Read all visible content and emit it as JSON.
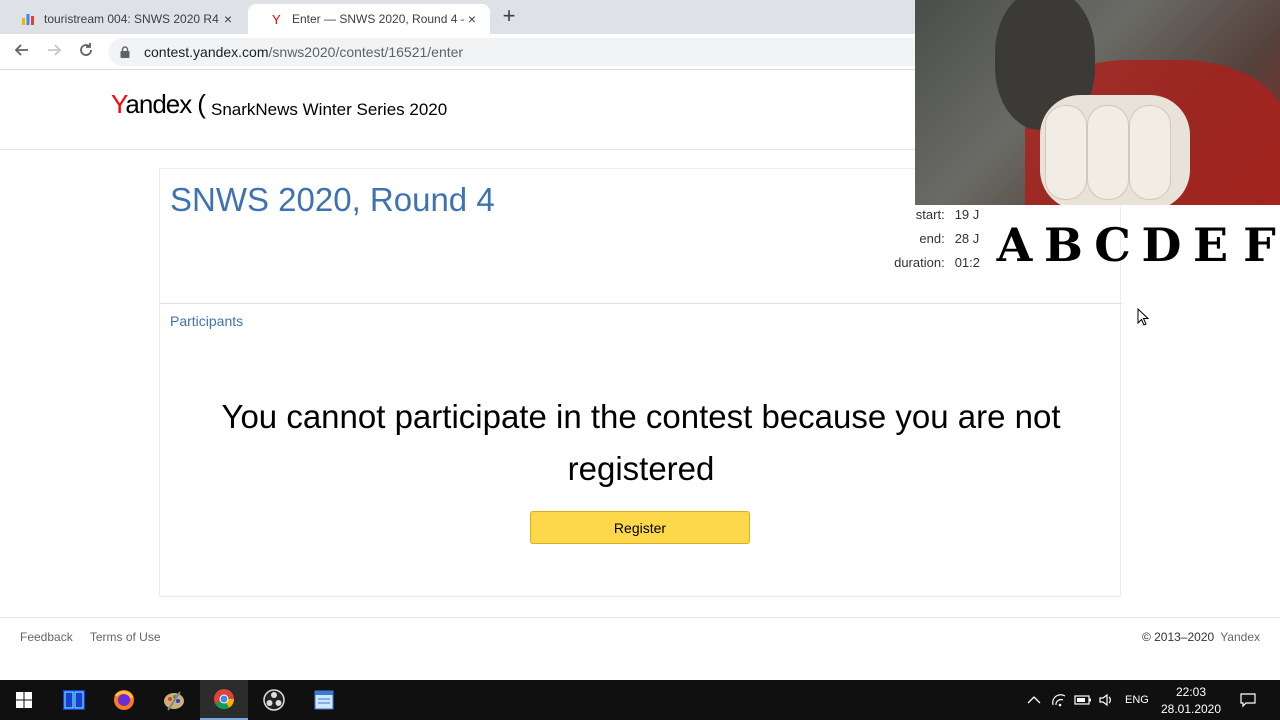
{
  "browser": {
    "tabs": [
      {
        "title": "touristream 004: SNWS 2020 R4",
        "active": false,
        "favicon": "bar-chart-favicon"
      },
      {
        "title": "Enter — SNWS 2020, Round 4 —",
        "active": true,
        "favicon": "yandex-favicon"
      }
    ],
    "close_glyph": "×",
    "new_tab_glyph": "+",
    "url_host": "contest.yandex.com",
    "url_path": "/snws2020/contest/16521/enter"
  },
  "header": {
    "logo_y": "Y",
    "logo_rest": "andex",
    "logo_suffix": "(",
    "contest_series": "SnarkNews Winter Series 2020"
  },
  "contest": {
    "title": "SNWS 2020, Round 4",
    "start_label": "start:",
    "start_value": "19 J",
    "end_label": "end:",
    "end_value": "28 J",
    "duration_label": "duration:",
    "duration_value": "01:2",
    "participants_link": "Participants",
    "message": "You cannot participate in the contest because you are not registered",
    "register_label": "Register"
  },
  "overlay_letters": [
    "A",
    "B",
    "C",
    "D",
    "E",
    "F"
  ],
  "footer": {
    "feedback": "Feedback",
    "terms": "Terms of Use",
    "copyright": "© 2013–2020",
    "brand": "Yandex"
  },
  "taskbar": {
    "language": "ENG",
    "time": "22:03",
    "date": "28.01.2020"
  },
  "colors": {
    "link_blue": "#3e73b2",
    "register_yellow": "#fcd84a",
    "yandex_red": "#ff0000"
  }
}
